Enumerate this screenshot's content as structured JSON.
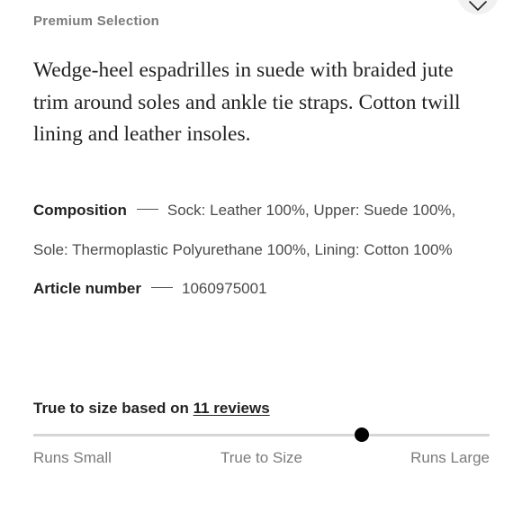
{
  "header": {
    "eyebrow": "Premium Selection",
    "favorite_icon": "heart-outline-icon"
  },
  "description": "Wedge-heel espadrilles in suede with braided jute trim around soles and ankle tie straps. Cotton twill lining and leather insoles.",
  "specs": {
    "composition_label": "Composition",
    "composition_value": "Sock: Leather 100%, Upper: Suede 100%, Sole: Thermoplastic Polyurethane 100%, Lining: Cotton 100%",
    "article_label": "Article number",
    "article_value": "1060975001"
  },
  "fit": {
    "heading_prefix": "True to size based on",
    "reviews_link": "11 reviews",
    "position_fraction": 0.72,
    "labels": {
      "small": "Runs Small",
      "true": "True to Size",
      "large": "Runs Large"
    }
  },
  "colors": {
    "text": "#222222",
    "muted": "#7b7b7b",
    "track": "#d6d6d6",
    "indicator": "#000000"
  }
}
